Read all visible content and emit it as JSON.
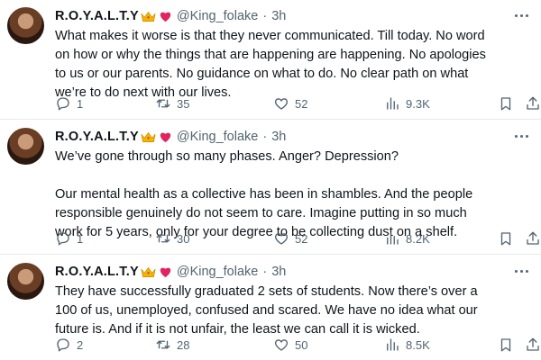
{
  "tweets": [
    {
      "author_name": "R.O.Y.A.L.T.Y",
      "handle": "@King_folake",
      "separator": "·",
      "time": "3h",
      "text": "What makes it worse is that they never communicated. Till today. No word\non how or why the things that are happening are happening. No apologies\nto us or our parents. No guidance on what to do. No clear path  on what\nwe’re to do next with our lives.",
      "replies": "1",
      "reposts": "35",
      "likes": "52",
      "views": "9.3K"
    },
    {
      "author_name": "R.O.Y.A.L.T.Y",
      "handle": "@King_folake",
      "separator": "·",
      "time": "3h",
      "text": "We’ve gone through so many phases. Anger? Depression?\n\nOur mental health as a collective has been in shambles. And the people\nresponsible genuinely do not seem to care. Imagine putting in so much\nwork for 5 years, only for your degree to be collecting dust on a shelf.",
      "replies": "1",
      "reposts": "30",
      "likes": "52",
      "views": "8.2K"
    },
    {
      "author_name": "R.O.Y.A.L.T.Y",
      "handle": "@King_folake",
      "separator": "·",
      "time": "3h",
      "text": "They have successfully graduated 2 sets of students. Now there’s over a\n100 of us, unemployed, confused and scared. We have no idea what our\nfuture is. And if it is not unfair, the least we can call it is wicked.",
      "replies": "2",
      "reposts": "28",
      "likes": "50",
      "views": "8.5K"
    }
  ],
  "icons": {
    "crown": "crown-emoji",
    "heart": "red-heart-emoji",
    "more": "more-dots-icon",
    "reply": "reply-icon",
    "repost": "repost-icon",
    "like": "like-icon",
    "views": "views-icon",
    "bookmark": "bookmark-icon",
    "share": "share-icon"
  },
  "colors": {
    "text": "#0f1419",
    "secondary": "#536471",
    "divider": "#e6e9ec",
    "crown": "#f4b400",
    "heart": "#e0245e"
  }
}
